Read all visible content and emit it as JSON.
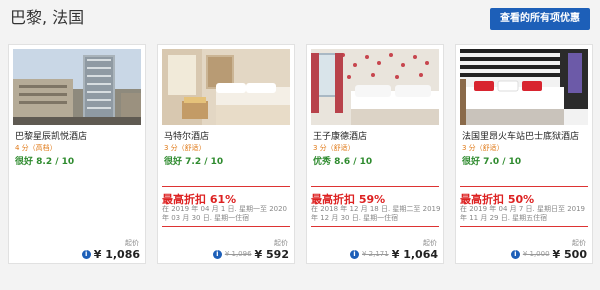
{
  "header": {
    "title": "巴黎, 法国",
    "view_all_label": "查看的所有项优惠"
  },
  "colors": {
    "accent": "#1d5fb8",
    "deal": "#dd2222",
    "rating": "#2f8b2f",
    "stars": "#e07a19"
  },
  "hotels": [
    {
      "name": "巴黎星辰凯悦酒店",
      "stars": "4 分（高档）",
      "rating": "很好 8.2 / 10",
      "from_label": "起价",
      "price": "¥ 1,086"
    },
    {
      "name": "马特尔酒店",
      "stars": "3 分（舒适）",
      "rating": "很好 7.2 / 10",
      "deal_title": "最高折扣 61%",
      "deal_dates": "在 2019 年 04 月 1 日. 星期一至 2020 年 03 月 30 日. 星期一住宿",
      "from_label": "起价",
      "old_price": "¥ 1,096",
      "price": "¥ 592"
    },
    {
      "name": "王子康德酒店",
      "stars": "3 分（舒适）",
      "rating": "优秀 8.6 / 10",
      "deal_title": "最高折扣 59%",
      "deal_dates": "在 2018 年 12 月 18 日. 星期二至 2019 年 12 月 30 日. 星期一住宿",
      "from_label": "起价",
      "old_price": "¥ 2,171",
      "price": "¥ 1,064"
    },
    {
      "name": "法国里昂火车站巴士底狱酒店",
      "stars": "3 分（舒适）",
      "rating": "很好 7.0 / 10",
      "deal_title": "最高折扣 50%",
      "deal_dates": "在 2019 年 04 月 7 日. 星期日至 2019 年 11 月 29 日. 星期五住宿",
      "from_label": "起价",
      "old_price": "¥ 1,000",
      "price": "¥ 500"
    }
  ]
}
